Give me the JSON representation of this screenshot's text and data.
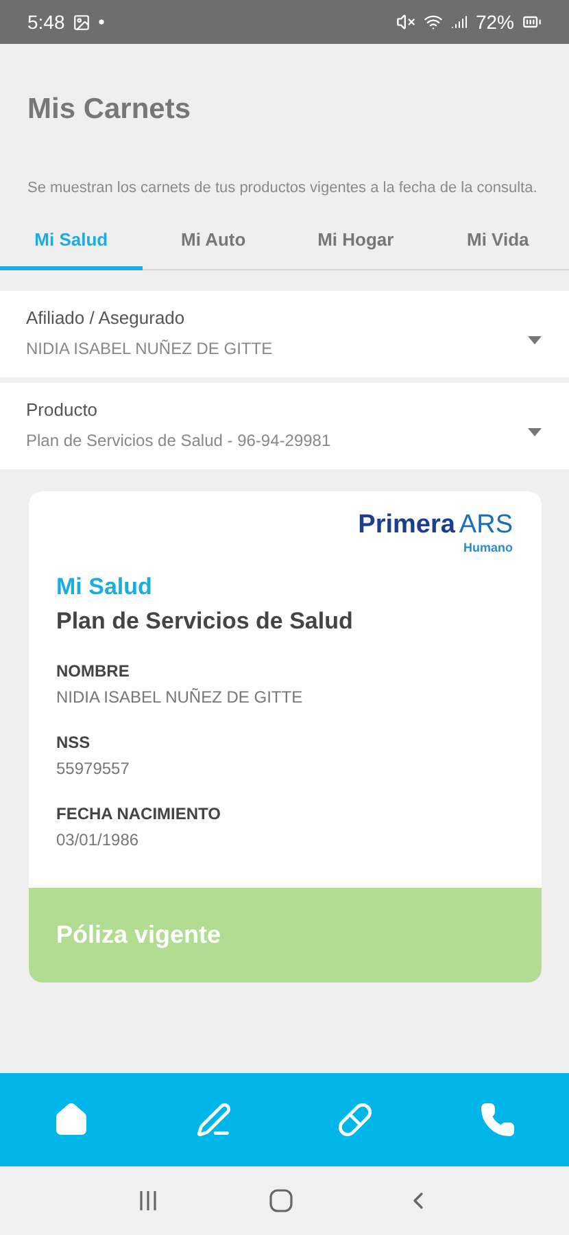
{
  "status_bar": {
    "time": "5:48",
    "battery": "72%"
  },
  "title": "Mis Carnets",
  "description": "Se muestran los carnets de tus productos vigentes a la fecha de la consulta.",
  "tabs": [
    {
      "label": "Mi Salud",
      "selected": true
    },
    {
      "label": "Mi Auto",
      "selected": false
    },
    {
      "label": "Mi Hogar",
      "selected": false
    },
    {
      "label": "Mi Vida",
      "selected": false
    }
  ],
  "selects": [
    {
      "label": "Afiliado / Asegurado",
      "value": "NIDIA ISABEL NUÑEZ DE GITTE"
    },
    {
      "label": "Producto",
      "value": "Plan de Servicios de Salud - 96-94-29981"
    }
  ],
  "card": {
    "logo": {
      "main": "Primera",
      "suffix": "ARS",
      "sub": "Humano"
    },
    "category": "Mi Salud",
    "plan": "Plan de Servicios de Salud",
    "fields": [
      {
        "label": "NOMBRE",
        "value": "NIDIA ISABEL NUÑEZ DE GITTE"
      },
      {
        "label": "NSS",
        "value": "55979557"
      },
      {
        "label": "FECHA NACIMIENTO",
        "value": "03/01/1986"
      }
    ],
    "status": "Póliza vigente"
  },
  "bottom_nav": [
    {
      "kind": "home"
    },
    {
      "kind": "pen"
    },
    {
      "kind": "pill"
    },
    {
      "kind": "phone"
    }
  ]
}
